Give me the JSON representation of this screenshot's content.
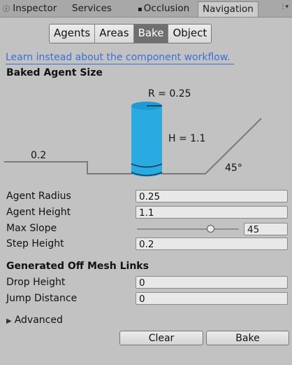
{
  "tabs": [
    {
      "label": "Inspector",
      "icon": "info-icon"
    },
    {
      "label": "Services",
      "icon": ""
    },
    {
      "label": "Occlusion",
      "icon": "lock-icon"
    },
    {
      "label": "Navigation",
      "icon": "",
      "active": true
    }
  ],
  "segments": [
    "Agents",
    "Areas",
    "Bake",
    "Object"
  ],
  "selected_segment": "Bake",
  "link_text": "Learn instead about the component workflow.",
  "baked_agent_size": {
    "header": "Baked Agent Size",
    "radius_label": "R = 0.25",
    "height_label": "H = 1.1",
    "step_label": "0.2",
    "slope_label": "45°"
  },
  "fields": {
    "agent_radius": {
      "label": "Agent Radius",
      "value": "0.25"
    },
    "agent_height": {
      "label": "Agent Height",
      "value": "1.1"
    },
    "max_slope": {
      "label": "Max Slope",
      "value": "45",
      "fraction": 0.72
    },
    "step_height": {
      "label": "Step Height",
      "value": "0.2"
    }
  },
  "offmesh": {
    "header": "Generated Off Mesh Links",
    "drop_height": {
      "label": "Drop Height",
      "value": "0"
    },
    "jump_distance": {
      "label": "Jump Distance",
      "value": "0"
    }
  },
  "advanced_label": "Advanced",
  "buttons": {
    "clear": "Clear",
    "bake": "Bake"
  },
  "colors": {
    "accent_link": "#3a6fd8",
    "agent_cylinder": "#29abe2"
  }
}
